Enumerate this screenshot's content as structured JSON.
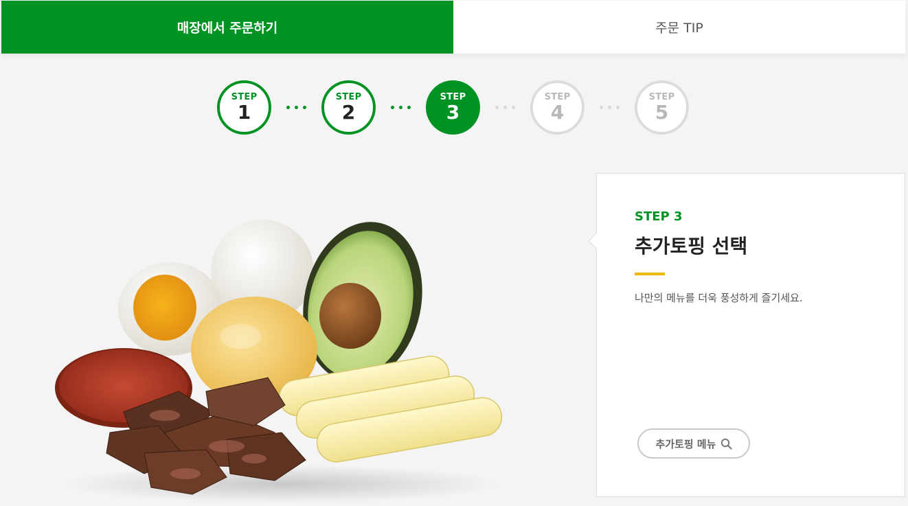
{
  "tabs": {
    "order_in_store": "매장에서 주문하기",
    "order_tip": "주문 TIP"
  },
  "steps": [
    {
      "label": "STEP",
      "number": "1",
      "state": "done"
    },
    {
      "label": "STEP",
      "number": "2",
      "state": "done"
    },
    {
      "label": "STEP",
      "number": "3",
      "state": "current"
    },
    {
      "label": "STEP",
      "number": "4",
      "state": "future"
    },
    {
      "label": "STEP",
      "number": "5",
      "state": "future"
    }
  ],
  "card": {
    "step_tag": "STEP 3",
    "title": "추가토핑 선택",
    "description": "나만의 메뉴를 더욱 풍성하게 즐기세요.",
    "menu_button": "추가토핑 메뉴",
    "menu_button_icon": "search-icon"
  },
  "colors": {
    "brand_green": "#009223",
    "accent_yellow": "#f2b705"
  }
}
